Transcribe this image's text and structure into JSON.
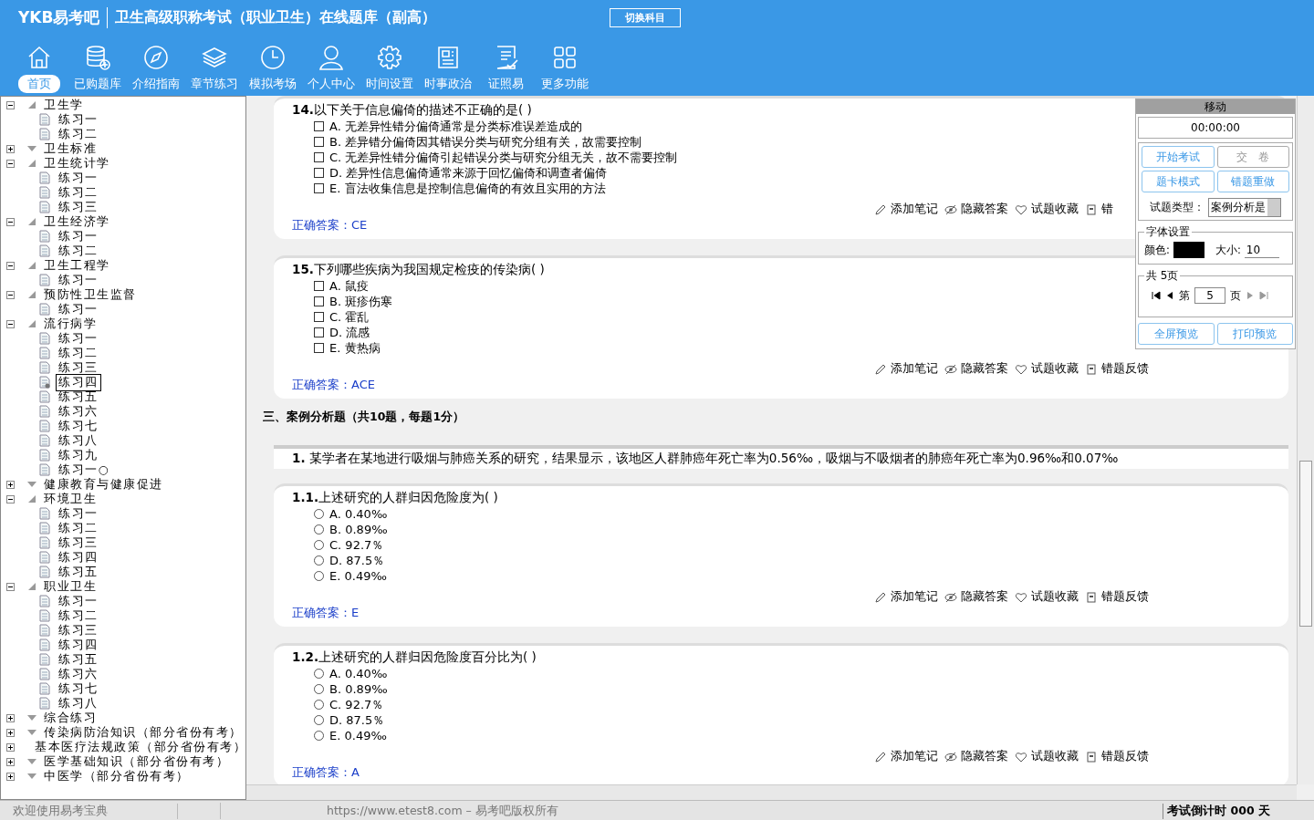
{
  "header": {
    "logo": "YKB易考吧",
    "title": "卫生高级职称考试（职业卫生）在线题库（副高）",
    "switch_button": "切换科目"
  },
  "nav": [
    {
      "label": "首页",
      "selected": true
    },
    {
      "label": "已购题库",
      "selected": false
    },
    {
      "label": "介绍指南",
      "selected": false
    },
    {
      "label": "章节练习",
      "selected": false
    },
    {
      "label": "模拟考场",
      "selected": false
    },
    {
      "label": "个人中心",
      "selected": false
    },
    {
      "label": "时间设置",
      "selected": false
    },
    {
      "label": "时事政治",
      "selected": false
    },
    {
      "label": "证照易",
      "selected": false
    },
    {
      "label": "更多功能",
      "selected": false
    }
  ],
  "tree": [
    {
      "label": "卫生学",
      "expanded": true,
      "children": [
        {
          "label": "练习一",
          "selected": false
        },
        {
          "label": "练习二",
          "selected": false
        }
      ]
    },
    {
      "label": "卫生标准",
      "expanded": false
    },
    {
      "label": "卫生统计学",
      "expanded": true,
      "children": [
        {
          "label": "练习一",
          "selected": false
        },
        {
          "label": "练习二",
          "selected": false
        },
        {
          "label": "练习三",
          "selected": false
        }
      ]
    },
    {
      "label": "卫生经济学",
      "expanded": true,
      "children": [
        {
          "label": "练习一",
          "selected": false
        },
        {
          "label": "练习二",
          "selected": false
        }
      ]
    },
    {
      "label": "卫生工程学",
      "expanded": true,
      "children": [
        {
          "label": "练习一",
          "selected": false
        }
      ]
    },
    {
      "label": "预防性卫生监督",
      "expanded": true,
      "children": [
        {
          "label": "练习一",
          "selected": false
        }
      ]
    },
    {
      "label": "流行病学",
      "expanded": true,
      "children": [
        {
          "label": "练习一",
          "selected": false
        },
        {
          "label": "练习二",
          "selected": false
        },
        {
          "label": "练习三",
          "selected": false
        },
        {
          "label": "练习四",
          "selected": true
        },
        {
          "label": "练习五",
          "selected": false
        },
        {
          "label": "练习六",
          "selected": false
        },
        {
          "label": "练习七",
          "selected": false
        },
        {
          "label": "练习八",
          "selected": false
        },
        {
          "label": "练习九",
          "selected": false
        },
        {
          "label": "练习一○",
          "selected": false
        }
      ]
    },
    {
      "label": "健康教育与健康促进",
      "expanded": false
    },
    {
      "label": "环境卫生",
      "expanded": true,
      "children": [
        {
          "label": "练习一",
          "selected": false
        },
        {
          "label": "练习二",
          "selected": false
        },
        {
          "label": "练习三",
          "selected": false
        },
        {
          "label": "练习四",
          "selected": false
        },
        {
          "label": "练习五",
          "selected": false
        }
      ]
    },
    {
      "label": "职业卫生",
      "expanded": true,
      "children": [
        {
          "label": "练习一",
          "selected": false
        },
        {
          "label": "练习二",
          "selected": false
        },
        {
          "label": "练习三",
          "selected": false
        },
        {
          "label": "练习四",
          "selected": false
        },
        {
          "label": "练习五",
          "selected": false
        },
        {
          "label": "练习六",
          "selected": false
        },
        {
          "label": "练习七",
          "selected": false
        },
        {
          "label": "练习八",
          "selected": false
        }
      ]
    },
    {
      "label": "综合练习",
      "expanded": false
    },
    {
      "label": "传染病防治知识（部分省份有考）",
      "expanded": false
    },
    {
      "label": "基本医疗法规政策（部分省份有考）",
      "expanded": false
    },
    {
      "label": "医学基础知识（部分省份有考）",
      "expanded": false
    },
    {
      "label": "中医学（部分省份有考）",
      "expanded": false
    }
  ],
  "questions_top": [
    {
      "kind": "multiple",
      "number": "14.",
      "text": "以下关于信息偏倚的描述不正确的是( )",
      "options": [
        {
          "letter": "A.",
          "text": "无差异性错分偏倚通常是分类标准误差造成的",
          "selected": false
        },
        {
          "letter": "B.",
          "text": "差异错分偏倚因其错误分类与研究分组有关，故需要控制",
          "selected": false
        },
        {
          "letter": "C.",
          "text": "无差异性错分偏倚引起错误分类与研究分组无关，故不需要控制",
          "selected": false
        },
        {
          "letter": "D.",
          "text": "差异性信息偏倚通常来源于回忆偏倚和调查者偏倚",
          "selected": false
        },
        {
          "letter": "E.",
          "text": "盲法收集信息是控制信息偏倚的有效且实用的方法",
          "selected": false
        }
      ],
      "answer_label": "正确答案：",
      "answer": "CE",
      "actions": [
        "添加笔记",
        "隐藏答案",
        "试题收藏",
        "错"
      ]
    },
    {
      "kind": "multiple",
      "number": "15.",
      "text": "下列哪些疾病为我国规定检疫的传染病( )",
      "options": [
        {
          "letter": "A.",
          "text": "鼠疫",
          "selected": false
        },
        {
          "letter": "B.",
          "text": "斑疹伤寒",
          "selected": false
        },
        {
          "letter": "C.",
          "text": "霍乱",
          "selected": false
        },
        {
          "letter": "D.",
          "text": "流感",
          "selected": false
        },
        {
          "letter": "E.",
          "text": "黄热病",
          "selected": false
        }
      ],
      "answer_label": "正确答案：",
      "answer": "ACE",
      "actions": [
        "添加笔记",
        "隐藏答案",
        "试题收藏",
        "错题反馈"
      ]
    }
  ],
  "section_heading": "三、案例分析题（共10题，每题1分）",
  "case": {
    "number": "1.",
    "text": "某学者在某地进行吸烟与肺癌关系的研究，结果显示，该地区人群肺癌年死亡率为0.56‰，吸烟与不吸烟者的肺癌年死亡率为0.96‰和0.07‰"
  },
  "questions_case": [
    {
      "kind": "single",
      "number": "1.1.",
      "text": "上述研究的人群归因危险度为( )",
      "options": [
        {
          "letter": "A.",
          "text": "0.40‰",
          "selected": false
        },
        {
          "letter": "B.",
          "text": "0.89‰",
          "selected": false
        },
        {
          "letter": "C.",
          "text": "92.7％",
          "selected": false
        },
        {
          "letter": "D.",
          "text": "87.5％",
          "selected": false
        },
        {
          "letter": "E.",
          "text": "0.49‰",
          "selected": false
        }
      ],
      "answer_label": "正确答案：",
      "answer": "E",
      "actions": [
        "添加笔记",
        "隐藏答案",
        "试题收藏",
        "错题反馈"
      ]
    },
    {
      "kind": "single",
      "number": "1.2.",
      "text": "上述研究的人群归因危险度百分比为( )",
      "options": [
        {
          "letter": "A.",
          "text": "0.40‰",
          "selected": false
        },
        {
          "letter": "B.",
          "text": "0.89‰",
          "selected": false
        },
        {
          "letter": "C.",
          "text": "92.7％",
          "selected": false
        },
        {
          "letter": "D.",
          "text": "87.5％",
          "selected": false
        },
        {
          "letter": "E.",
          "text": "0.49‰",
          "selected": false
        }
      ],
      "answer_label": "正确答案：",
      "answer": "A",
      "actions": [
        "添加笔记",
        "隐藏答案",
        "试题收藏",
        "错题反馈"
      ]
    }
  ],
  "panel": {
    "title": "移动",
    "timer": "00:00:00",
    "buttons": [
      {
        "label": "开始考试",
        "disabled": false
      },
      {
        "label": "交　卷",
        "disabled": true
      },
      {
        "label": "题卡模式",
        "disabled": false
      },
      {
        "label": "错题重做",
        "disabled": false
      }
    ],
    "type_label": "试题类型：",
    "type_value": "案例分析是",
    "font_legend": "字体设置",
    "color_label": "颜色:",
    "color": "#000000",
    "size_label": "大小:",
    "size_value": "10",
    "pages_legend": "共 5页",
    "page_prefix": "第",
    "page_value": "5",
    "page_suffix": "页",
    "bottom_buttons": [
      "全屏预览",
      "打印预览"
    ]
  },
  "status_bar": {
    "welcome": "欢迎使用易考宝典",
    "copyright": "https://www.etest8.com – 易考吧版权所有",
    "countdown": "考试倒计时 000 天"
  }
}
